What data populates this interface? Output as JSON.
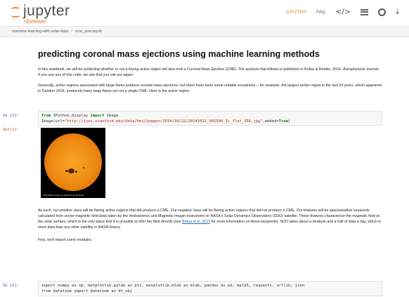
{
  "header": {
    "logo_name": "jupyter",
    "logo_sub": "nbviewer",
    "nav": {
      "jupyter_label": "JUPYTER",
      "faq_label": "FAQ",
      "code_icon": "</>"
    }
  },
  "breadcrumb": {
    "items": [
      "machine-learning-with-solar-data",
      "cme_svm.ipynb"
    ],
    "separator": "/"
  },
  "notebook": {
    "title": "predicting coronal mass ejections using machine learning methods",
    "intro_1": "In this notebook, we will be predicting whether or not a flaring active region will also emit a Coronal Mass Ejection (CME). The analysis that follows is published in Bobra & Ilonidis, 2016, ",
    "intro_1_em": "Astrophysical Journal",
    "intro_1_tail": ". If you use any of this code, we ask that you cite our paper.",
    "intro_2": "Generally, active regions associated with large flares produce coronal mass ejections, but there have been some notable exceptions -- for example, the largest active region in the last 24 years, which appeared in October 2014, produced many large flares yet not a single CME. Here is the active region:",
    "cell1": {
      "prompt": "In [1]:",
      "line1_kw1": "from",
      "line1_mod": "IPython.display",
      "line1_kw2": "import",
      "line1_name": "Image",
      "line2_pre": "Image(url=",
      "line2_str": "\"http://jsoc.stanford.edu/data/hmi/images/2014/10/22/20141022_001500_Ic_flat_256.jpg\"",
      "line2_post": ",embed=",
      "line2_true": "True",
      "line2_end": ")"
    },
    "out1": {
      "prompt": "Out[1]:",
      "image_caption": "SDO/HMI Continuum  2014-10-22 00:15:00"
    },
    "body_1_pre": "As such, our positive class will be flaring active regions that did produce a CME. Our negative class will be flaring active regions that did not produce a CME. Our features will be spaceweather keywords calculated from vector magnetic field data taken by the Helioseismic and Magnetic Imager instrument on NASA's Solar Dynamics Observatory (SDO) satellite. These features characterize the magnetic field at the solar surface, which is the only place that it is possible to infer the field directly (see ",
    "body_1_link": "Bobra et al. 2014",
    "body_1_post": " for more information on these keywords). SDO takes about a terabyte and a half of data a day, which is more data than any other satellite in NASA history.",
    "body_2": "First, we'll import some modules.",
    "cell2": {
      "prompt": "In [2]:",
      "line1": "import numpy as np, matplotlib.pylab as plt, matplotlib.mlab as mlab, pandas as pd, mpld3, requests, urllib, json",
      "line2": "from datetime import datetime as dt_obj"
    }
  },
  "colors": {
    "accent": "#f37626",
    "link": "#2a6ebb",
    "in_prompt": "#303f9f",
    "out_prompt": "#d84315"
  }
}
